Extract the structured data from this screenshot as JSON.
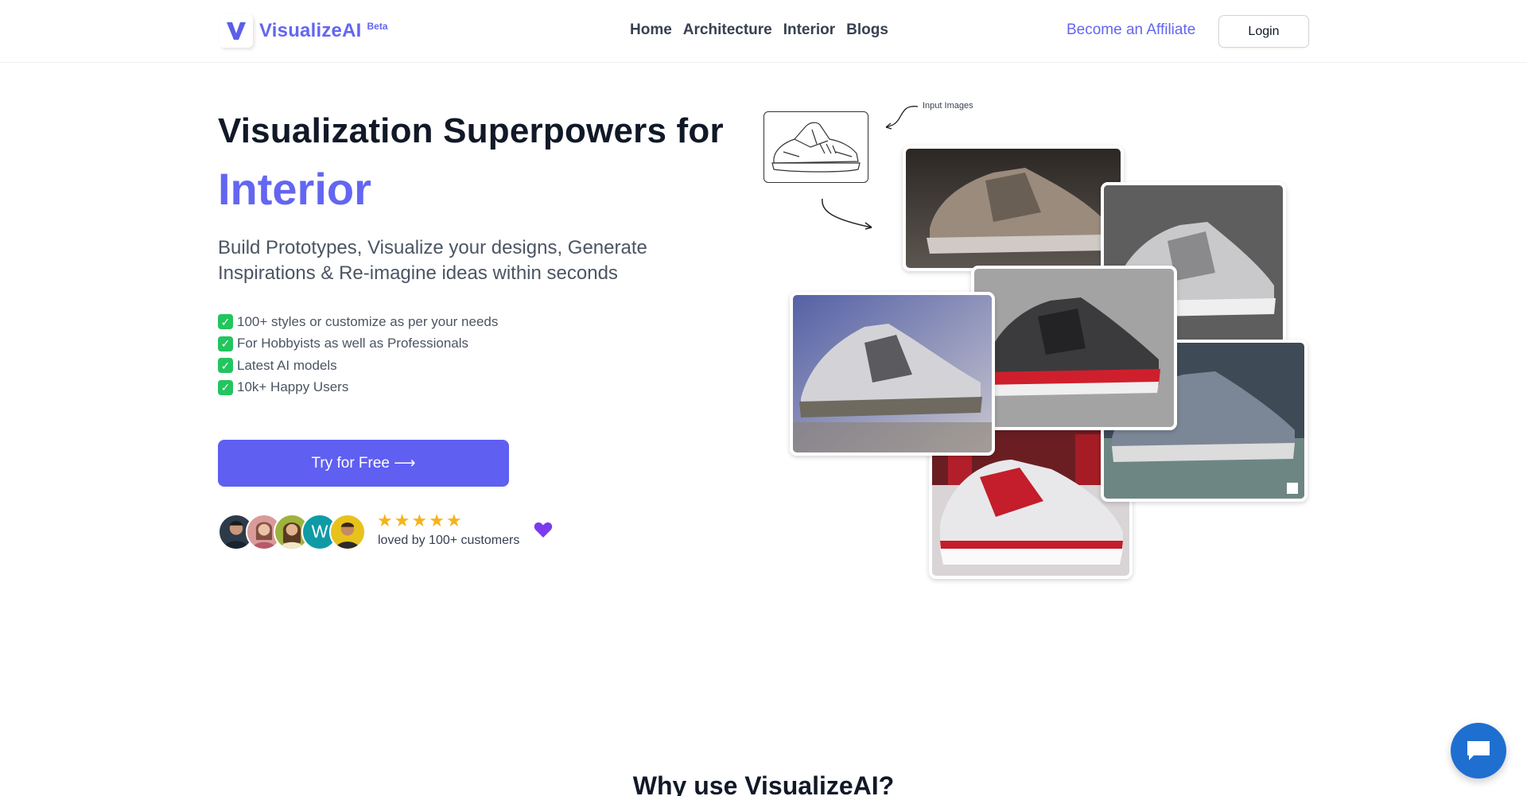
{
  "header": {
    "brand": "VisualizeAI",
    "badge": "Beta",
    "nav": [
      "Home",
      "Architecture",
      "Interior",
      "Blogs"
    ],
    "affiliate": "Become an Affiliate",
    "login": "Login"
  },
  "hero": {
    "title": "Visualization Superpowers for",
    "rotating_word": "Interior",
    "subtitle": "Build Prototypes, Visualize your designs, Generate Inspirations & Re-imagine ideas within seconds",
    "features": [
      "100+ styles or customize as per your needs",
      "For Hobbyists as well as Professionals",
      "Latest AI models",
      "10k+ Happy Users"
    ],
    "cta": "Try for Free ⟶",
    "rating": 5,
    "loved": "loved by 100+ customers",
    "avatar_letter": "W"
  },
  "collage": {
    "note": "Input Images"
  },
  "section": {
    "title": "Why use VisualizeAI?"
  },
  "icons": {
    "logo": "logo-v-icon",
    "check": "check-icon",
    "star": "star-icon",
    "heart": "purple-heart-icon",
    "chat": "chat-bubble-icon"
  },
  "colors": {
    "brand": "#6366f1",
    "cta": "#5f5ff1",
    "star": "#f5b31b",
    "chat": "#1f6fd1"
  }
}
